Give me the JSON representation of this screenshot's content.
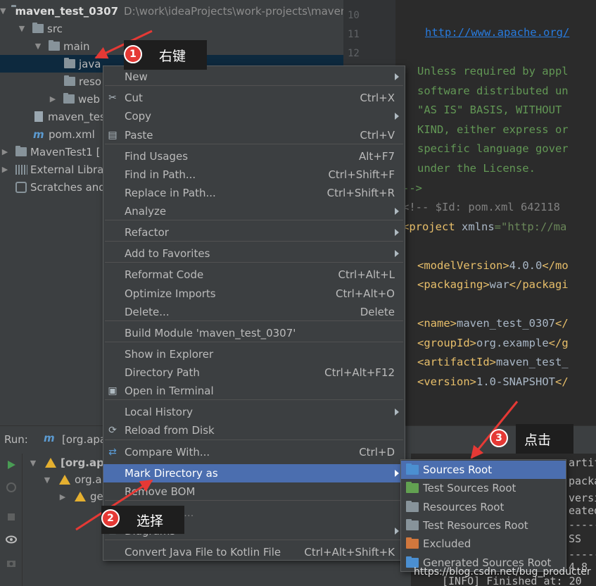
{
  "project_tree": {
    "root_name": "maven_test_0307",
    "root_path": "D:\\work\\ideaProjects\\work-projects\\maven",
    "src": "src",
    "main": "main",
    "java": "java",
    "resources_trunc": "reso",
    "webapp_trunc": "web",
    "iml_trunc": "maven_tes",
    "pom": "pom.xml",
    "maventest1": "MavenTest1 [",
    "external_libs": "External Libra",
    "scratches": "Scratches and"
  },
  "editor": {
    "line_numbers": [
      "10",
      "11",
      "12"
    ],
    "lines": [
      {
        "parts": [
          {
            "t": "http://www.apache.org/",
            "c": "link"
          }
        ]
      },
      {
        "parts": [
          {
            "t": "Unless required by appl",
            "c": "doc"
          }
        ]
      },
      {
        "parts": [
          {
            "t": "software distributed un",
            "c": "doc"
          }
        ]
      },
      {
        "parts": [
          {
            "t": "\"AS IS\" BASIS, WITHOUT ",
            "c": "doc"
          }
        ]
      },
      {
        "parts": [
          {
            "t": "KIND, either express or",
            "c": "doc"
          }
        ]
      },
      {
        "parts": [
          {
            "t": "specific language gover",
            "c": "doc"
          }
        ]
      },
      {
        "parts": [
          {
            "t": "under the License.",
            "c": "doc"
          }
        ]
      },
      {
        "parts": [
          {
            "t": "-->",
            "c": "doc"
          }
        ]
      },
      {
        "parts": [
          {
            "t": "<!-- $Id: pom.xml 642118",
            "c": "cmt"
          }
        ]
      },
      {
        "parts": [
          {
            "t": "<project ",
            "c": "tag"
          },
          {
            "t": "xmlns",
            "c": "txt"
          },
          {
            "t": "=\"http://ma",
            "c": "str"
          }
        ]
      },
      {
        "parts": [
          {
            "t": "<modelVersion>",
            "c": "tag"
          },
          {
            "t": "4.0.0",
            "c": "txt"
          },
          {
            "t": "</mo",
            "c": "tag"
          }
        ]
      },
      {
        "parts": [
          {
            "t": "<packaging>",
            "c": "tag"
          },
          {
            "t": "war",
            "c": "txt"
          },
          {
            "t": "</packagi",
            "c": "tag"
          }
        ]
      },
      {
        "parts": [
          {
            "t": "<name>",
            "c": "tag"
          },
          {
            "t": "maven_test_0307",
            "c": "txt"
          },
          {
            "t": "</",
            "c": "tag"
          }
        ]
      },
      {
        "parts": [
          {
            "t": "<groupId>",
            "c": "tag"
          },
          {
            "t": "org.example",
            "c": "txt"
          },
          {
            "t": "</g",
            "c": "tag"
          }
        ]
      },
      {
        "parts": [
          {
            "t": "<artifactId>",
            "c": "tag"
          },
          {
            "t": "maven_test_",
            "c": "txt"
          }
        ]
      },
      {
        "parts": [
          {
            "t": "<version>",
            "c": "tag"
          },
          {
            "t": "1.0-SNAPSHOT",
            "c": "txt"
          },
          {
            "t": "</",
            "c": "tag"
          }
        ]
      }
    ]
  },
  "run_panel": {
    "label": "Run:",
    "tab": "[org.apa",
    "tree": [
      "[org.apa",
      "org.a",
      "ge"
    ],
    "console": [
      "artifa",
      "packag",
      "versio",
      "eated",
      "-----",
      "SS",
      "-----",
      "4.8",
      "[INFO] Finished at: 20"
    ]
  },
  "context_menu": {
    "items": [
      {
        "label": "New",
        "shortcut": "",
        "submenu": true,
        "icon": ""
      },
      {
        "label": "Cut",
        "shortcut": "Ctrl+X",
        "submenu": false,
        "icon": "scissors-icon"
      },
      {
        "label": "Copy",
        "shortcut": "",
        "submenu": true,
        "icon": ""
      },
      {
        "label": "Paste",
        "shortcut": "Ctrl+V",
        "submenu": false,
        "icon": "clipboard-icon"
      },
      {
        "label": "Find Usages",
        "shortcut": "Alt+F7",
        "submenu": false,
        "icon": ""
      },
      {
        "label": "Find in Path...",
        "shortcut": "Ctrl+Shift+F",
        "submenu": false,
        "icon": ""
      },
      {
        "label": "Replace in Path...",
        "shortcut": "Ctrl+Shift+R",
        "submenu": false,
        "icon": ""
      },
      {
        "label": "Analyze",
        "shortcut": "",
        "submenu": true,
        "icon": ""
      },
      {
        "label": "Refactor",
        "shortcut": "",
        "submenu": true,
        "icon": ""
      },
      {
        "label": "Add to Favorites",
        "shortcut": "",
        "submenu": true,
        "icon": ""
      },
      {
        "label": "Reformat Code",
        "shortcut": "Ctrl+Alt+L",
        "submenu": false,
        "icon": ""
      },
      {
        "label": "Optimize Imports",
        "shortcut": "Ctrl+Alt+O",
        "submenu": false,
        "icon": ""
      },
      {
        "label": "Delete...",
        "shortcut": "Delete",
        "submenu": false,
        "icon": ""
      },
      {
        "label": "Build Module 'maven_test_0307'",
        "shortcut": "",
        "submenu": false,
        "icon": ""
      },
      {
        "label": "Show in Explorer",
        "shortcut": "",
        "submenu": false,
        "icon": ""
      },
      {
        "label": "Directory Path",
        "shortcut": "Ctrl+Alt+F12",
        "submenu": false,
        "icon": ""
      },
      {
        "label": "Open in Terminal",
        "shortcut": "",
        "submenu": false,
        "icon": "terminal-icon"
      },
      {
        "label": "Local History",
        "shortcut": "",
        "submenu": true,
        "icon": ""
      },
      {
        "label": "Reload from Disk",
        "shortcut": "",
        "submenu": false,
        "icon": "reload-icon"
      },
      {
        "label": "Compare With...",
        "shortcut": "Ctrl+D",
        "submenu": false,
        "icon": "compare-icon"
      },
      {
        "label": "Mark Directory as",
        "shortcut": "",
        "submenu": true,
        "icon": ""
      },
      {
        "label": "Remove BOM",
        "shortcut": "",
        "submenu": false,
        "icon": ""
      },
      {
        "label": "Create Gist...",
        "shortcut": "",
        "submenu": false,
        "icon": "github-icon"
      },
      {
        "label": "Diagrams",
        "shortcut": "",
        "submenu": true,
        "icon": "diagram-icon"
      },
      {
        "label": "Convert Java File to Kotlin File",
        "shortcut": "Ctrl+Alt+Shift+K",
        "submenu": false,
        "icon": ""
      }
    ]
  },
  "submenu": {
    "items": [
      {
        "label": "Sources Root",
        "color": "#4b8fd1"
      },
      {
        "label": "Test Sources Root",
        "color": "#62a151"
      },
      {
        "label": "Resources Root",
        "color": "#87939a"
      },
      {
        "label": "Test Resources Root",
        "color": "#87939a"
      },
      {
        "label": "Excluded",
        "color": "#d0773d"
      },
      {
        "label": "Generated Sources Root",
        "color": "#4b8fd1"
      }
    ]
  },
  "annotations": {
    "step1_num": "1",
    "step1_text": "右键",
    "step2_num": "2",
    "step2_text": "选择",
    "step3_num": "3",
    "step3_text": "点击"
  },
  "watermark": "https://blog.csdn.net/bug_producter",
  "colors": {
    "menu_bg": "#3c3f41",
    "highlight": "#4b6eaf",
    "annotation_red": "#e53935"
  }
}
